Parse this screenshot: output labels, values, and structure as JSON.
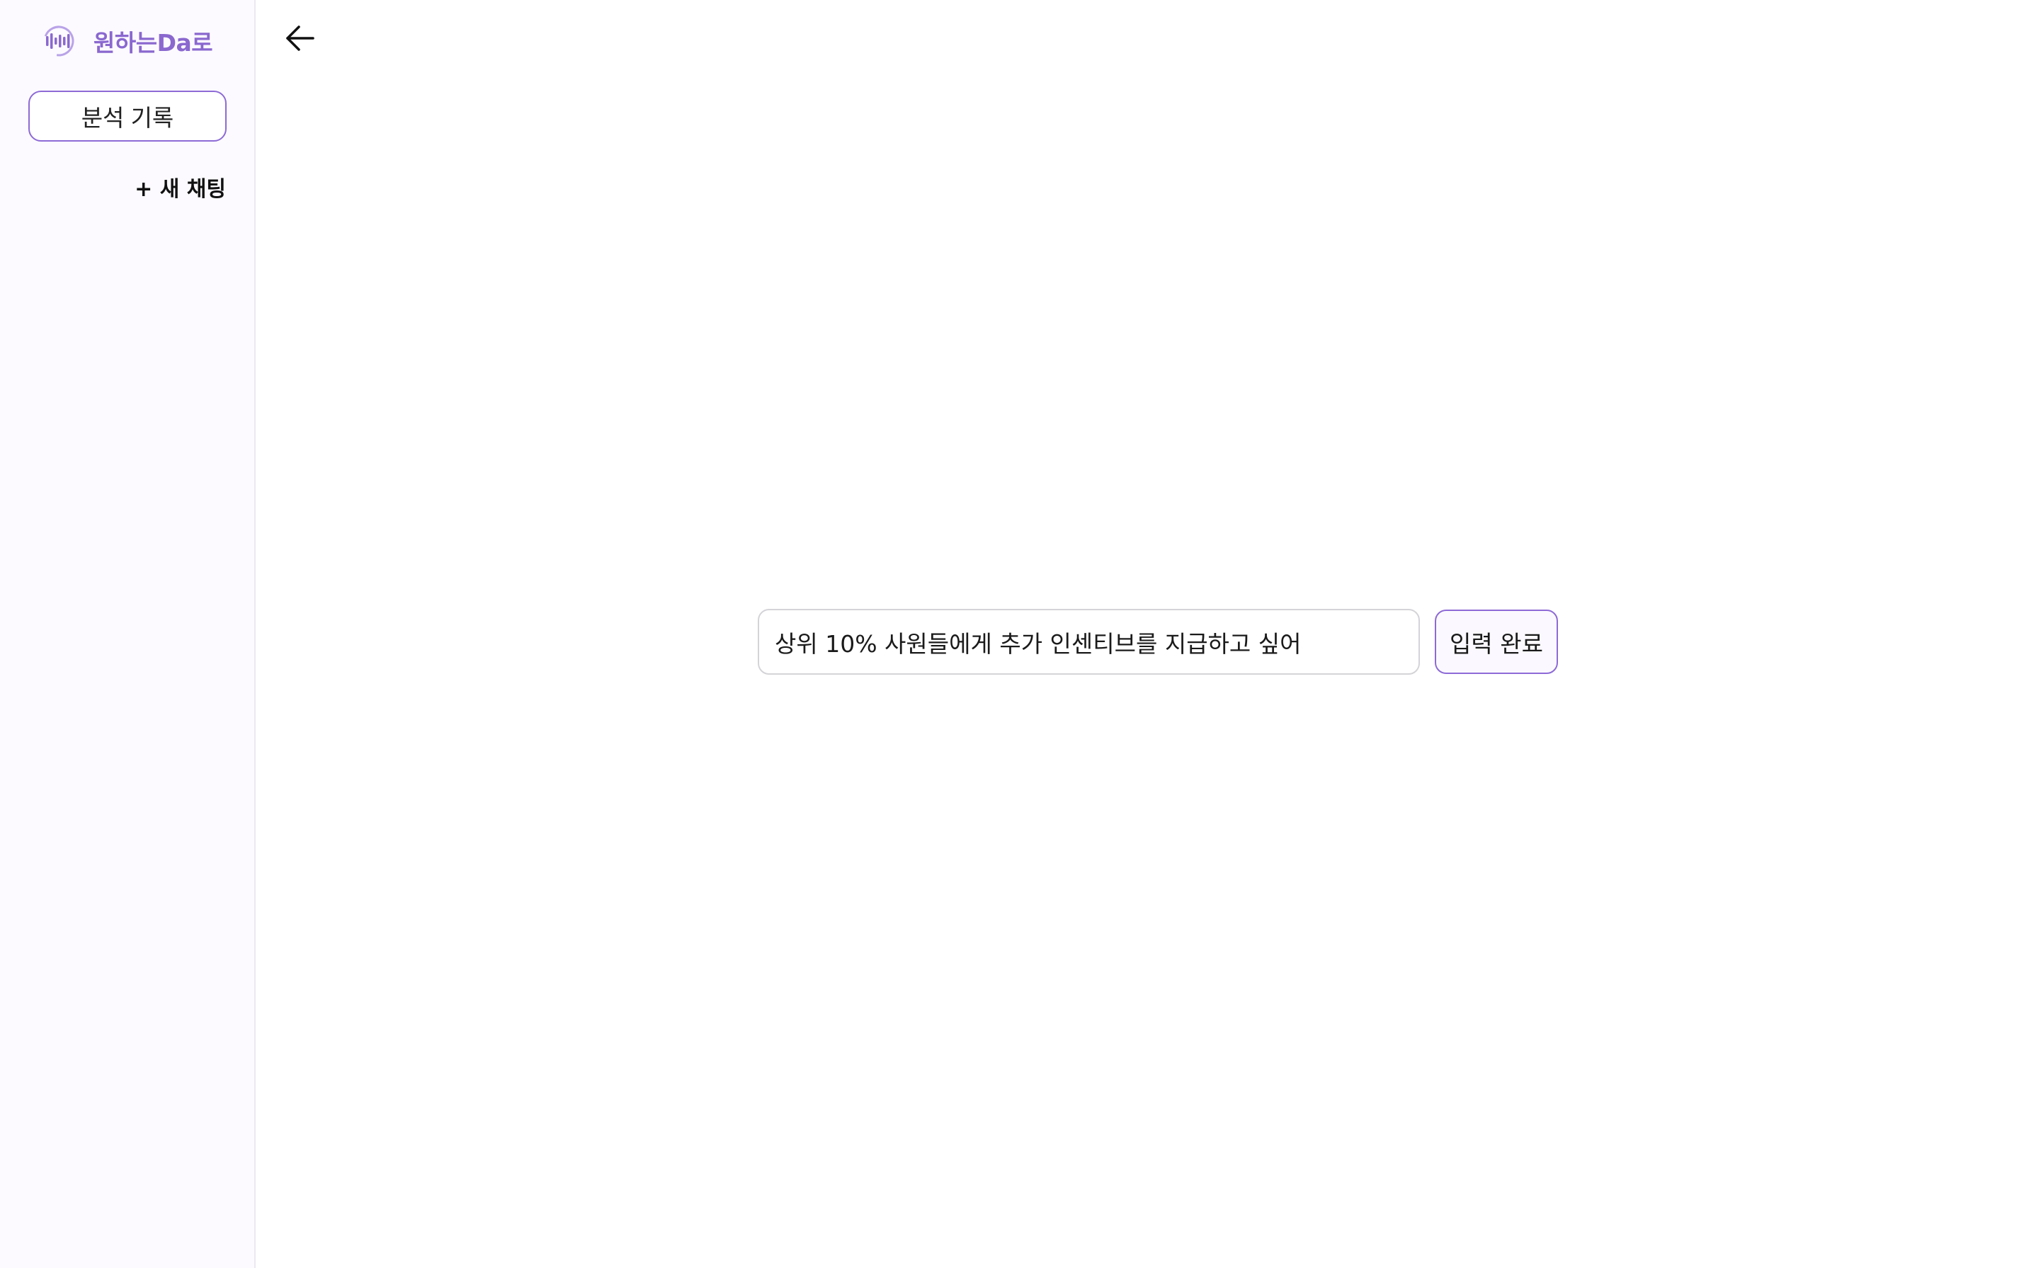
{
  "app": {
    "brand_name": "원하는Da로",
    "logo_icon": "audio-wave-logo-icon",
    "accent_color": "#8d6ad6"
  },
  "sidebar": {
    "history_button_label": "분석 기록",
    "new_chat_label": "+ 새 채팅"
  },
  "header": {
    "back_icon": "arrow-left-icon"
  },
  "query": {
    "value": "상위 10% 사원들에게 추가 인센티브를 지급하고 싶어",
    "submit_label": "입력 완료"
  }
}
